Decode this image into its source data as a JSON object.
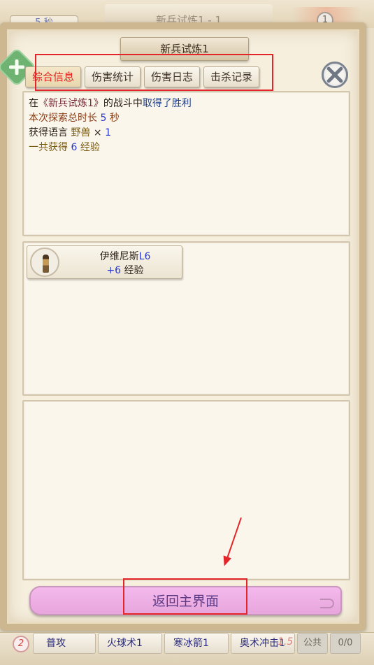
{
  "background": {
    "timer": "5 秒",
    "stage_title": "新兵试炼1 - 1",
    "badge_number": "1"
  },
  "dialog": {
    "title": "新兵试炼1"
  },
  "tabs": [
    {
      "label": "综合信息",
      "active": true
    },
    {
      "label": "伤害统计",
      "active": false
    },
    {
      "label": "伤害日志",
      "active": false
    },
    {
      "label": "击杀记录",
      "active": false
    }
  ],
  "summary": {
    "line1": {
      "prefix": "在",
      "stage": "《新兵试炼1》",
      "middle": "的战斗中",
      "result": "取得了胜利"
    },
    "line2": {
      "label": "本次探索总时长",
      "value": "5",
      "unit": "秒"
    },
    "line3": {
      "label": "获得语言",
      "item": "野兽",
      "times": "×",
      "count": "1"
    },
    "line4": {
      "label": "一共获得",
      "value": "6",
      "unit": "经验"
    }
  },
  "hero": {
    "name": "伊维尼斯",
    "level": "L6",
    "exp_gain": "+6",
    "exp_unit": "经验"
  },
  "return_button": "返回主界面",
  "skillbar": {
    "count": "2",
    "skills": [
      {
        "label": "普攻"
      },
      {
        "label": "火球术1"
      },
      {
        "label": "寒冰箭1"
      },
      {
        "label": "奥术冲击1"
      }
    ],
    "cooldown": "1.5",
    "public_label": "公共",
    "ratio": "0/0"
  },
  "colors": {
    "highlight": "#e4262a",
    "active_tab": "#e3231f",
    "return_button_bg": "#f4b9ec"
  }
}
